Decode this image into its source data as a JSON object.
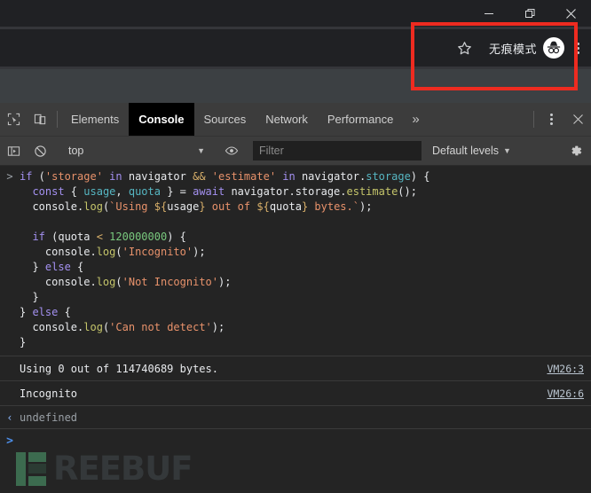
{
  "window": {
    "minimize_label": "Minimize",
    "restore_label": "Restore",
    "close_label": "Close"
  },
  "browser": {
    "star_icon": "star-icon",
    "incognito_label": "无痕模式",
    "incognito_icon": "incognito-spy-icon",
    "menu_icon": "kebab-menu-icon"
  },
  "highlight": {
    "color": "#ee2b20"
  },
  "devtools": {
    "inspect_icon": "inspect-element-icon",
    "device_icon": "device-toolbar-icon",
    "tabs": [
      {
        "label": "Elements",
        "active": false
      },
      {
        "label": "Console",
        "active": true
      },
      {
        "label": "Sources",
        "active": false
      },
      {
        "label": "Network",
        "active": false
      },
      {
        "label": "Performance",
        "active": false
      }
    ],
    "overflow_label": "»",
    "more_icon": "vertical-dots-icon",
    "close_icon": "close-icon",
    "console_toolbar": {
      "sidebar_icon": "console-sidebar-icon",
      "clear_icon": "clear-console-icon",
      "context": "top",
      "eye_icon": "live-expression-eye-icon",
      "filter_placeholder": "Filter",
      "filter_value": "",
      "levels_label": "Default levels",
      "settings_icon": "gear-icon"
    }
  },
  "console": {
    "input_prompt": ">",
    "code_lines": [
      [
        {
          "t": "kw",
          "s": "if"
        },
        {
          "t": "op",
          "s": " ("
        },
        {
          "t": "str",
          "s": "'storage'"
        },
        {
          "t": "op",
          "s": " "
        },
        {
          "t": "kw",
          "s": "in"
        },
        {
          "t": "op",
          "s": " navigator "
        },
        {
          "t": "sub",
          "s": "&&"
        },
        {
          "t": "op",
          "s": " "
        },
        {
          "t": "str",
          "s": "'estimate'"
        },
        {
          "t": "op",
          "s": " "
        },
        {
          "t": "kw",
          "s": "in"
        },
        {
          "t": "op",
          "s": " navigator."
        },
        {
          "t": "var",
          "s": "storage"
        },
        {
          "t": "op",
          "s": ") {"
        }
      ],
      [
        {
          "t": "op",
          "s": "  "
        },
        {
          "t": "kw",
          "s": "const"
        },
        {
          "t": "op",
          "s": " { "
        },
        {
          "t": "var",
          "s": "usage"
        },
        {
          "t": "op",
          "s": ", "
        },
        {
          "t": "var",
          "s": "quota"
        },
        {
          "t": "op",
          "s": " } = "
        },
        {
          "t": "kw",
          "s": "await"
        },
        {
          "t": "op",
          "s": " navigator.storage."
        },
        {
          "t": "fn",
          "s": "estimate"
        },
        {
          "t": "op",
          "s": "();"
        }
      ],
      [
        {
          "t": "op",
          "s": "  console."
        },
        {
          "t": "fn",
          "s": "log"
        },
        {
          "t": "op",
          "s": "("
        },
        {
          "t": "tpl",
          "s": "`Using "
        },
        {
          "t": "sub",
          "s": "${"
        },
        {
          "t": "pl",
          "s": "usage"
        },
        {
          "t": "sub",
          "s": "}"
        },
        {
          "t": "tpl",
          "s": " out of "
        },
        {
          "t": "sub",
          "s": "${"
        },
        {
          "t": "pl",
          "s": "quota"
        },
        {
          "t": "sub",
          "s": "}"
        },
        {
          "t": "tpl",
          "s": " bytes.`"
        },
        {
          "t": "op",
          "s": ");"
        }
      ],
      [],
      [
        {
          "t": "op",
          "s": "  "
        },
        {
          "t": "kw",
          "s": "if"
        },
        {
          "t": "op",
          "s": " (quota "
        },
        {
          "t": "sub",
          "s": "<"
        },
        {
          "t": "op",
          "s": " "
        },
        {
          "t": "num",
          "s": "120000000"
        },
        {
          "t": "op",
          "s": ") {"
        }
      ],
      [
        {
          "t": "op",
          "s": "    console."
        },
        {
          "t": "fn",
          "s": "log"
        },
        {
          "t": "op",
          "s": "("
        },
        {
          "t": "str",
          "s": "'Incognito'"
        },
        {
          "t": "op",
          "s": ");"
        }
      ],
      [
        {
          "t": "op",
          "s": "  } "
        },
        {
          "t": "kw",
          "s": "else"
        },
        {
          "t": "op",
          "s": " {"
        }
      ],
      [
        {
          "t": "op",
          "s": "    console."
        },
        {
          "t": "fn",
          "s": "log"
        },
        {
          "t": "op",
          "s": "("
        },
        {
          "t": "str",
          "s": "'Not Incognito'"
        },
        {
          "t": "op",
          "s": ");"
        }
      ],
      [
        {
          "t": "op",
          "s": "  }"
        }
      ],
      [
        {
          "t": "op",
          "s": "} "
        },
        {
          "t": "kw",
          "s": "else"
        },
        {
          "t": "op",
          "s": " {"
        }
      ],
      [
        {
          "t": "op",
          "s": "  console."
        },
        {
          "t": "fn",
          "s": "log"
        },
        {
          "t": "op",
          "s": "("
        },
        {
          "t": "str",
          "s": "'Can not detect'"
        },
        {
          "t": "op",
          "s": ");"
        }
      ],
      [
        {
          "t": "op",
          "s": "}"
        }
      ]
    ],
    "logs": [
      {
        "message": "Using 0 out of 114740689 bytes.",
        "source": "VM26:3"
      },
      {
        "message": "Incognito",
        "source": "VM26:6"
      }
    ],
    "result": {
      "arrow": "‹",
      "value": "undefined"
    }
  },
  "watermark": {
    "text": "REEBUF",
    "mark_color": "#3c6b4f"
  }
}
